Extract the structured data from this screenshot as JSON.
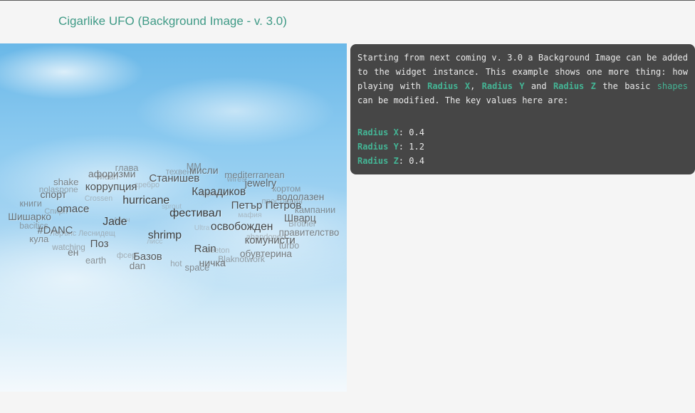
{
  "page": {
    "title": "Cigarlike UFO (Background Image - v. 3.0)"
  },
  "info": {
    "intro": "Starting from next coming v. 3.0 a Background Image can be added to the widget instance. This example shows one more thing: how playing with ",
    "term_x": "Radius X",
    "sep1": ", ",
    "term_y": "Radius Y",
    "sep2": " and ",
    "term_z": "Radius Z",
    "middle": " the basic ",
    "term_shapes": "shapes",
    "outro": " can be modified. The key values here are:",
    "values": [
      {
        "label": "Radius X",
        "value": ": 0.4"
      },
      {
        "label": "Radius Y",
        "value": ": 1.2"
      },
      {
        "label": "Radius Z",
        "value": ": 0.4"
      }
    ]
  },
  "colors": {
    "accent": "#44b595",
    "title": "#3f9a86",
    "info_bg": "#464646"
  },
  "tag_cloud": {
    "words": [
      "space",
      "dan",
      "hot",
      "ничка",
      "earth",
      "Blaknotwork",
      "Базов",
      "фсер",
      "обувтерина",
      "ен",
      "beeton",
      "Rain",
      "watching",
      "turbo",
      "Поз",
      "лисс",
      "комунисти",
      "кулa",
      "abandoned",
      "shrimp",
      "Лорънс Леснидещ",
      "правителство",
      "#DANC",
      "Ultra",
      "освобожден",
      "bacitics",
      "Brother",
      "Jade",
      "Арон",
      "Шварц",
      "Шишарко",
      "мафия",
      "фестивал",
      "Спирн",
      "кампании",
      "omace",
      "sprout",
      "Петър Петров",
      "книги",
      "простащия",
      "hurricane",
      "Crossen",
      "водолазен",
      "спорт",
      "фрактал",
      "Карадиков",
      "nolaspone",
      "кортом",
      "коррупция",
      "сребро",
      "jewelry",
      "shake",
      "wires",
      "Станишев",
      "Mean",
      "mediterranean",
      "афоризми",
      "техвент",
      "мисли",
      "глава",
      "MM"
    ]
  }
}
